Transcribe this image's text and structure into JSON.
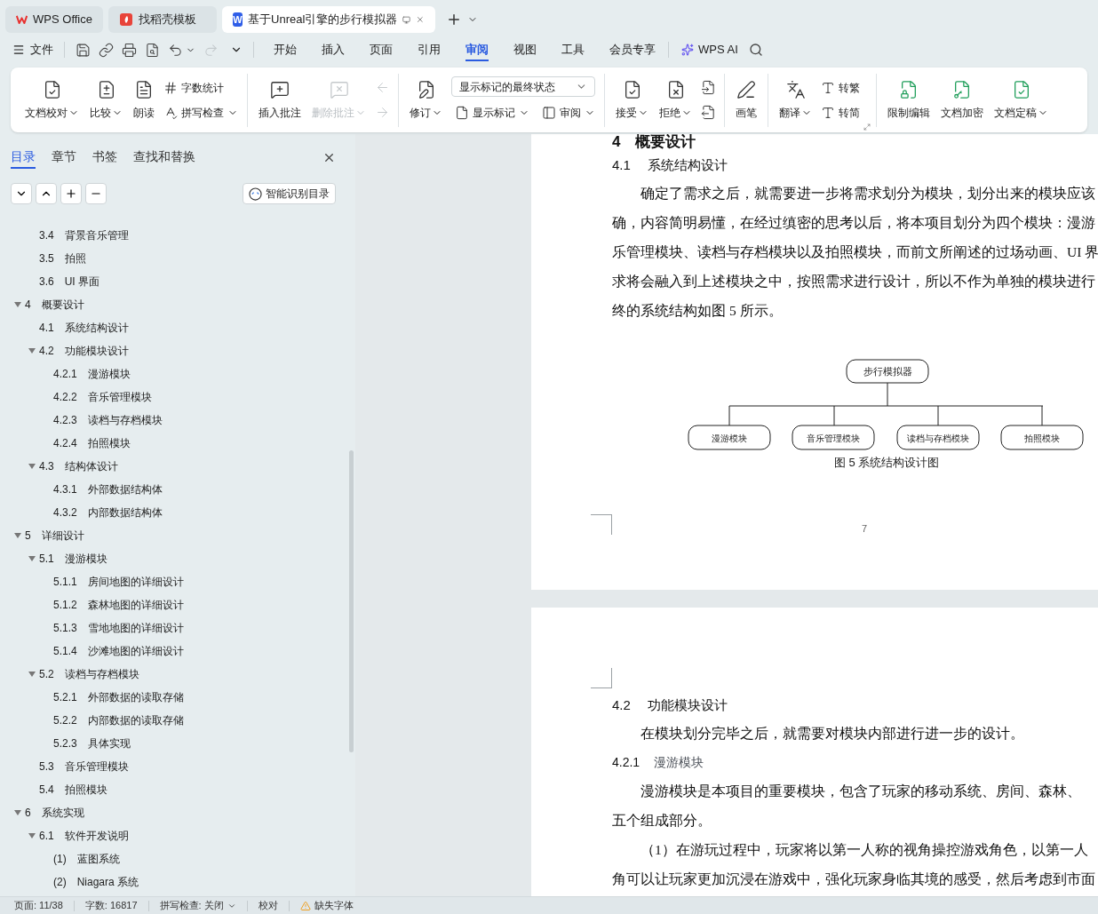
{
  "tabs": [
    {
      "kind": "home",
      "label": "WPS Office",
      "selected": false
    },
    {
      "kind": "template",
      "label": "找稻壳模板",
      "selected": false
    },
    {
      "kind": "document",
      "logo": "W",
      "label": "基于Unreal引擎的步行模拟器",
      "selected": true
    }
  ],
  "menu": {
    "file": "文件",
    "redo_disabled": true,
    "tabs": [
      {
        "label": "开始",
        "selected": false
      },
      {
        "label": "插入",
        "selected": false
      },
      {
        "label": "页面",
        "selected": false
      },
      {
        "label": "引用",
        "selected": false
      },
      {
        "label": "审阅",
        "selected": true
      },
      {
        "label": "视图",
        "selected": false
      },
      {
        "label": "工具",
        "selected": false
      },
      {
        "label": "会员专享",
        "selected": false
      }
    ],
    "ai": "WPS AI"
  },
  "ribbon": {
    "proofread": {
      "label": "文档校对",
      "dropdown": true
    },
    "compare": {
      "label": "比较",
      "dropdown": true
    },
    "read_aloud": {
      "label": "朗读",
      "dropdown": false
    },
    "word_count": {
      "label": "字数统计",
      "dropdown": false
    },
    "spell_check": {
      "label": "拼写检查",
      "dropdown": true
    },
    "insert_comment": {
      "label": "插入批注",
      "dropdown": false,
      "disabled": false
    },
    "delete_comment": {
      "label": "删除批注",
      "dropdown": true,
      "disabled": true
    },
    "prev_comment": {
      "disabled": true
    },
    "next_comment": {
      "disabled": true
    },
    "track_changes": {
      "label": "修订",
      "dropdown": true
    },
    "markup_view": {
      "value": "显示标记的最终状态"
    },
    "show_markup": {
      "label": "显示标记",
      "dropdown": true
    },
    "review_pane": {
      "label": "审阅",
      "dropdown": true
    },
    "accept": {
      "label": "接受",
      "dropdown": true
    },
    "reject": {
      "label": "拒绝",
      "dropdown": true
    },
    "prev_change": {
      "disabled": false
    },
    "next_change": {
      "disabled": false
    },
    "pen": {
      "label": "画笔",
      "dropdown": false
    },
    "translate": {
      "label": "翻译",
      "dropdown": true
    },
    "to_traditional": {
      "label": "转繁",
      "dropdown": false
    },
    "to_simplified": {
      "label": "转简",
      "dropdown": false
    },
    "restrict_editing": {
      "label": "限制编辑",
      "dropdown": false
    },
    "encrypt": {
      "label": "文档加密",
      "dropdown": false
    },
    "finalize": {
      "label": "文档定稿",
      "dropdown": true
    }
  },
  "nav_pane": {
    "tabs": [
      {
        "label": "目录",
        "selected": true
      },
      {
        "label": "章节",
        "selected": false
      },
      {
        "label": "书签",
        "selected": false
      },
      {
        "label": "查找和替换",
        "selected": false
      }
    ],
    "smart_toc": "智能识别目录",
    "toc_continued": [
      {
        "number": "3.4",
        "title": "背景音乐管理"
      },
      {
        "number": "3.5",
        "title": "拍照"
      },
      {
        "number": "3.6",
        "title": "UI 界面"
      }
    ],
    "toc": [
      {
        "number": "4",
        "title": "概要设计",
        "expanded": true,
        "children": [
          {
            "number": "4.1",
            "title": "系统结构设计"
          },
          {
            "number": "4.2",
            "title": "功能模块设计",
            "expanded": true,
            "children": [
              {
                "number": "4.2.1",
                "title": "漫游模块"
              },
              {
                "number": "4.2.2",
                "title": "音乐管理模块"
              },
              {
                "number": "4.2.3",
                "title": "读档与存档模块"
              },
              {
                "number": "4.2.4",
                "title": "拍照模块"
              }
            ]
          },
          {
            "number": "4.3",
            "title": "结构体设计",
            "expanded": true,
            "children": [
              {
                "number": "4.3.1",
                "title": "外部数据结构体"
              },
              {
                "number": "4.3.2",
                "title": "内部数据结构体"
              }
            ]
          }
        ]
      },
      {
        "number": "5",
        "title": "详细设计",
        "expanded": true,
        "children": [
          {
            "number": "5.1",
            "title": "漫游模块",
            "expanded": true,
            "children": [
              {
                "number": "5.1.1",
                "title": "房间地图的详细设计"
              },
              {
                "number": "5.1.2",
                "title": "森林地图的详细设计"
              },
              {
                "number": "5.1.3",
                "title": "雪地地图的详细设计"
              },
              {
                "number": "5.1.4",
                "title": "沙滩地图的详细设计"
              }
            ]
          },
          {
            "number": "5.2",
            "title": "读档与存档模块",
            "expanded": true,
            "children": [
              {
                "number": "5.2.1",
                "title": "外部数据的读取存储"
              },
              {
                "number": "5.2.2",
                "title": "内部数据的读取存储"
              },
              {
                "number": "5.2.3",
                "title": "具体实现"
              }
            ]
          },
          {
            "number": "5.3",
            "title": "音乐管理模块"
          },
          {
            "number": "5.4",
            "title": "拍照模块"
          }
        ]
      },
      {
        "number": "6",
        "title": "系统实现",
        "expanded": true,
        "children": [
          {
            "number": "6.1",
            "title": "软件开发说明",
            "expanded": true,
            "children": [
              {
                "number": "(1)",
                "title": "蓝图系统"
              },
              {
                "number": "(2)",
                "title": "Niagara 系统"
              }
            ]
          }
        ]
      }
    ]
  },
  "document": {
    "pages": [
      {
        "blocks": [
          {
            "kind": "heading1",
            "number": "4",
            "title": "概要设计"
          },
          {
            "kind": "heading2",
            "number": "4.1",
            "title": "系统结构设计"
          },
          {
            "kind": "paragraph",
            "lines": [
              "确定了需求之后，就需要进一步将需求划分为模块，划分出来的模块应该",
              "确，内容简明易懂，在经过缜密的思考以后，将本项目划分为四个模块：漫游",
              "乐管理模块、读档与存档模块以及拍照模块，而前文所阐述的过场动画、UI 界",
              "求将会融入到上述模块之中，按照需求进行设计，所以不作为单独的模块进行",
              "终的系统结构如图 5 所示。"
            ]
          },
          {
            "kind": "figure",
            "root": "步行模拟器",
            "children": [
              "漫游模块",
              "音乐管理模块",
              "读档与存档模块",
              "拍照模块"
            ],
            "caption": "图 5  系统结构设计图"
          }
        ],
        "page_number": "7"
      },
      {
        "blocks": [
          {
            "kind": "heading2",
            "number": "4.2",
            "title": "功能模块设计"
          },
          {
            "kind": "paragraph",
            "lines": [
              "在模块划分完毕之后，就需要对模块内部进行进一步的设计。"
            ]
          },
          {
            "kind": "heading3",
            "number": "4.2.1",
            "title": "漫游模块"
          },
          {
            "kind": "paragraph",
            "lines": [
              "漫游模块是本项目的重要模块，包含了玩家的移动系统、房间、森林、",
              "五个组成部分。"
            ]
          },
          {
            "kind": "paragraph",
            "lines": [
              "（1）在游玩过程中，玩家将以第一人称的视角操控游戏角色，以第一人",
              "角可以让玩家更加沉浸在游戏中，强化玩家身临其境的感受，然后考虑到市面"
            ]
          }
        ]
      }
    ]
  },
  "status_bar": [
    {
      "kind": "text",
      "label": "页面: 11/38"
    },
    {
      "kind": "text",
      "label": "字数: 16817"
    },
    {
      "kind": "dropdown",
      "label": "拼写检查: 关闭"
    },
    {
      "kind": "text",
      "label": "校对"
    },
    {
      "kind": "warning",
      "label": "缺失字体"
    }
  ]
}
